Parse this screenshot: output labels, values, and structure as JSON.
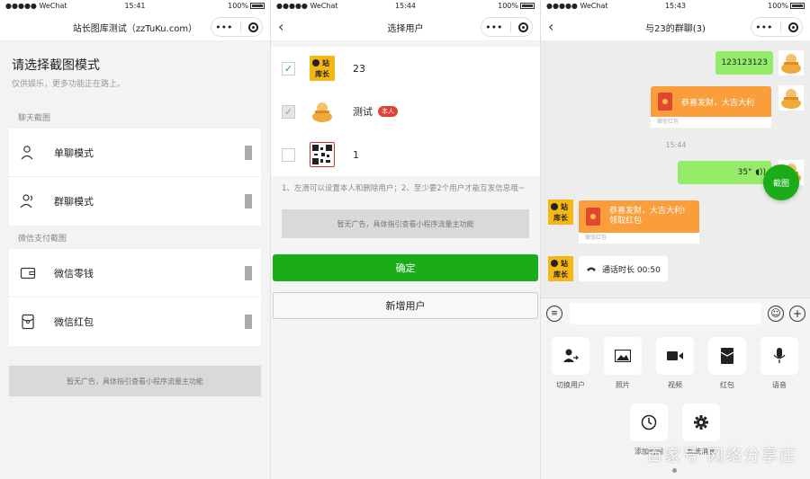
{
  "status": {
    "carrier": "●●●●● WeChat",
    "battery_percent": "100%",
    "battery_level": 1.0,
    "time_1": "15:41",
    "time_2": "15:44",
    "time_3": "15:43"
  },
  "panel1": {
    "nav_title": "站长图库测试（zzTuKu.com）",
    "heading": "请选择截图模式",
    "subheading": "仅供娱乐，更多功能正在路上。",
    "section_chat": "聊天截图",
    "single_mode": "单聊模式",
    "group_mode": "群聊模式",
    "section_pay": "微信支付截图",
    "wallet": "微信零钱",
    "redpacket": "微信红包",
    "ad_text": "暂无广告，具体指引查看小程序流量主功能"
  },
  "panel2": {
    "nav_title": "选择用户",
    "users": [
      {
        "name": "23",
        "checked": true
      },
      {
        "name": "测试",
        "checked": true,
        "badge": "本人"
      },
      {
        "name": "1",
        "checked": false
      }
    ],
    "logo_text": "站长 库",
    "hint": "1、左滑可以设置本人和删除用户；2、至少要2个用户才能互发信息哦~",
    "ad_text": "暂无广告，具体指引查看小程序流量主功能",
    "confirm": "确定",
    "add_user": "新增用户"
  },
  "panel3": {
    "nav_title": "与23的群聊(3)",
    "msg_text": "123123123",
    "redpacket_greeting": "恭喜发财，大吉大利",
    "redpacket_label": "微信红包",
    "time_divider": "15:44",
    "voice_duration": "35\"",
    "redpacket2_greeting": "恭喜发财，大吉大利!",
    "redpacket2_sub": "领取红包",
    "call_text": "通话时长 00:50",
    "fab_label": "截图",
    "tiles": [
      "切换用户",
      "照片",
      "视频",
      "红包",
      "语音",
      "添加时间",
      "系统消息"
    ]
  },
  "watermark": "百家号 网络分享庄"
}
